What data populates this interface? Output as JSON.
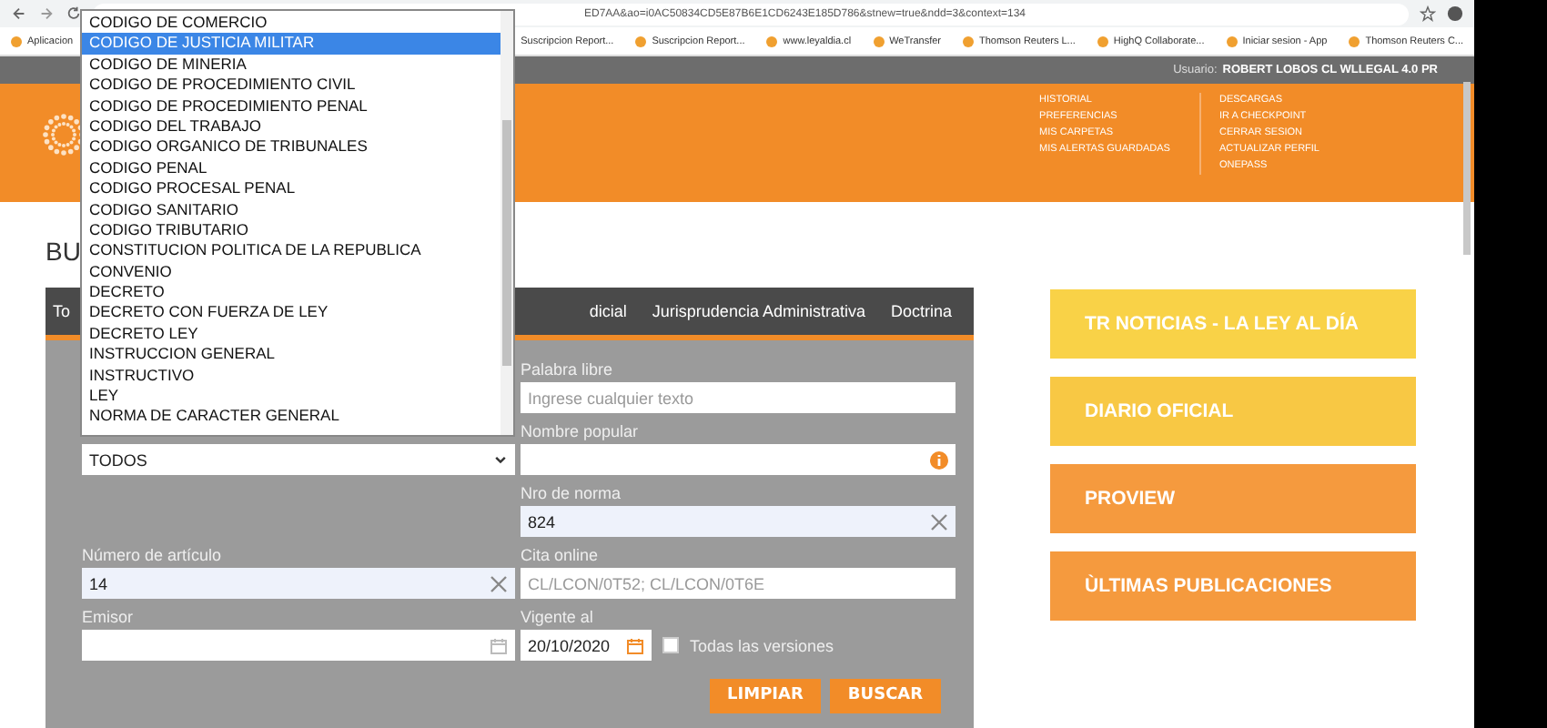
{
  "browser": {
    "url": "ED7AA&ao=i0AC50834CD5E87B6E1CD6243E185D786&stnew=true&ndd=3&context=134",
    "bookmarks": [
      "Aplicacion",
      "Suscripcion Report...",
      "Suscripcion Report...",
      "www.leyaldia.cl",
      "WeTransfer",
      "Thomson Reuters L...",
      "HighQ Collaborate...",
      "Iniciar sesion - App",
      "Thomson Reuters C..."
    ]
  },
  "user_bar": {
    "label": "Usuario:",
    "name": "ROBERT LOBOS CL WLLEGAL 4.0 PR"
  },
  "header": {
    "menu_left": [
      "HISTORIAL",
      "PREFERENCIAS",
      "MIS CARPETAS",
      "MIS ALERTAS GUARDADAS"
    ],
    "menu_right": [
      "DESCARGAS",
      "IR A CHECKPOINT",
      "CERRAR SESION",
      "ACTUALIZAR PERFIL",
      "ONEPASS"
    ]
  },
  "page_title": "BU",
  "tabs": [
    "To",
    "dicial",
    "Jurisprudencia Administrativa",
    "Doctrina"
  ],
  "form": {
    "palabra_libre": {
      "label": "Palabra libre",
      "placeholder": "Ingrese cualquier texto"
    },
    "tipo": {
      "value": "TODOS"
    },
    "nombre_popular": {
      "label": "Nombre popular"
    },
    "nro_norma": {
      "label": "Nro de norma",
      "value": "824"
    },
    "numero_articulo": {
      "label": "Número de artículo",
      "value": "14"
    },
    "cita_online": {
      "label": "Cita online",
      "placeholder": "CL/LCON/0T52; CL/LCON/0T6E"
    },
    "emisor": {
      "label": "Emisor"
    },
    "vigente_al": {
      "label": "Vigente al",
      "value": "20/10/2020"
    },
    "todas_versiones": {
      "label": "Todas las versiones",
      "checked": false
    },
    "buttons": [
      "LIMPIAR",
      "BUSCAR"
    ]
  },
  "dropdown": {
    "options": [
      {
        "label": "CODIGO DE COMERCIO",
        "selected": false
      },
      {
        "label": "CODIGO DE JUSTICIA MILITAR",
        "selected": true
      },
      {
        "label": "CODIGO DE MINERIA",
        "selected": false
      },
      {
        "label": "CODIGO DE PROCEDIMIENTO CIVIL",
        "selected": false
      },
      {
        "label": "CODIGO DE PROCEDIMIENTO PENAL",
        "selected": false
      },
      {
        "label": "CODIGO DEL TRABAJO",
        "selected": false
      },
      {
        "label": "CODIGO ORGANICO DE TRIBUNALES",
        "selected": false
      },
      {
        "label": "CODIGO PENAL",
        "selected": false
      },
      {
        "label": "CODIGO PROCESAL PENAL",
        "selected": false
      },
      {
        "label": "CODIGO SANITARIO",
        "selected": false
      },
      {
        "label": "CODIGO TRIBUTARIO",
        "selected": false
      },
      {
        "label": "CONSTITUCION POLITICA DE LA REPUBLICA",
        "selected": false
      },
      {
        "label": "CONVENIO",
        "selected": false
      },
      {
        "label": "DECRETO",
        "selected": false
      },
      {
        "label": "DECRETO CON FUERZA DE LEY",
        "selected": false
      },
      {
        "label": "DECRETO LEY",
        "selected": false
      },
      {
        "label": "INSTRUCCION GENERAL",
        "selected": false
      },
      {
        "label": "INSTRUCTIVO",
        "selected": false
      },
      {
        "label": "LEY",
        "selected": false
      },
      {
        "label": "NORMA DE CARACTER GENERAL",
        "selected": false
      }
    ]
  },
  "side_links": [
    {
      "label": "TR NOTICIAS - LA LEY AL DÍA",
      "color": "#f9d247"
    },
    {
      "label": "DIARIO OFICIAL",
      "color": "#f8c844"
    },
    {
      "label": "PROVIEW",
      "color": "#f59a3e"
    },
    {
      "label": "ÙLTIMAS PUBLICACIONES",
      "color": "#f59a3e"
    }
  ]
}
